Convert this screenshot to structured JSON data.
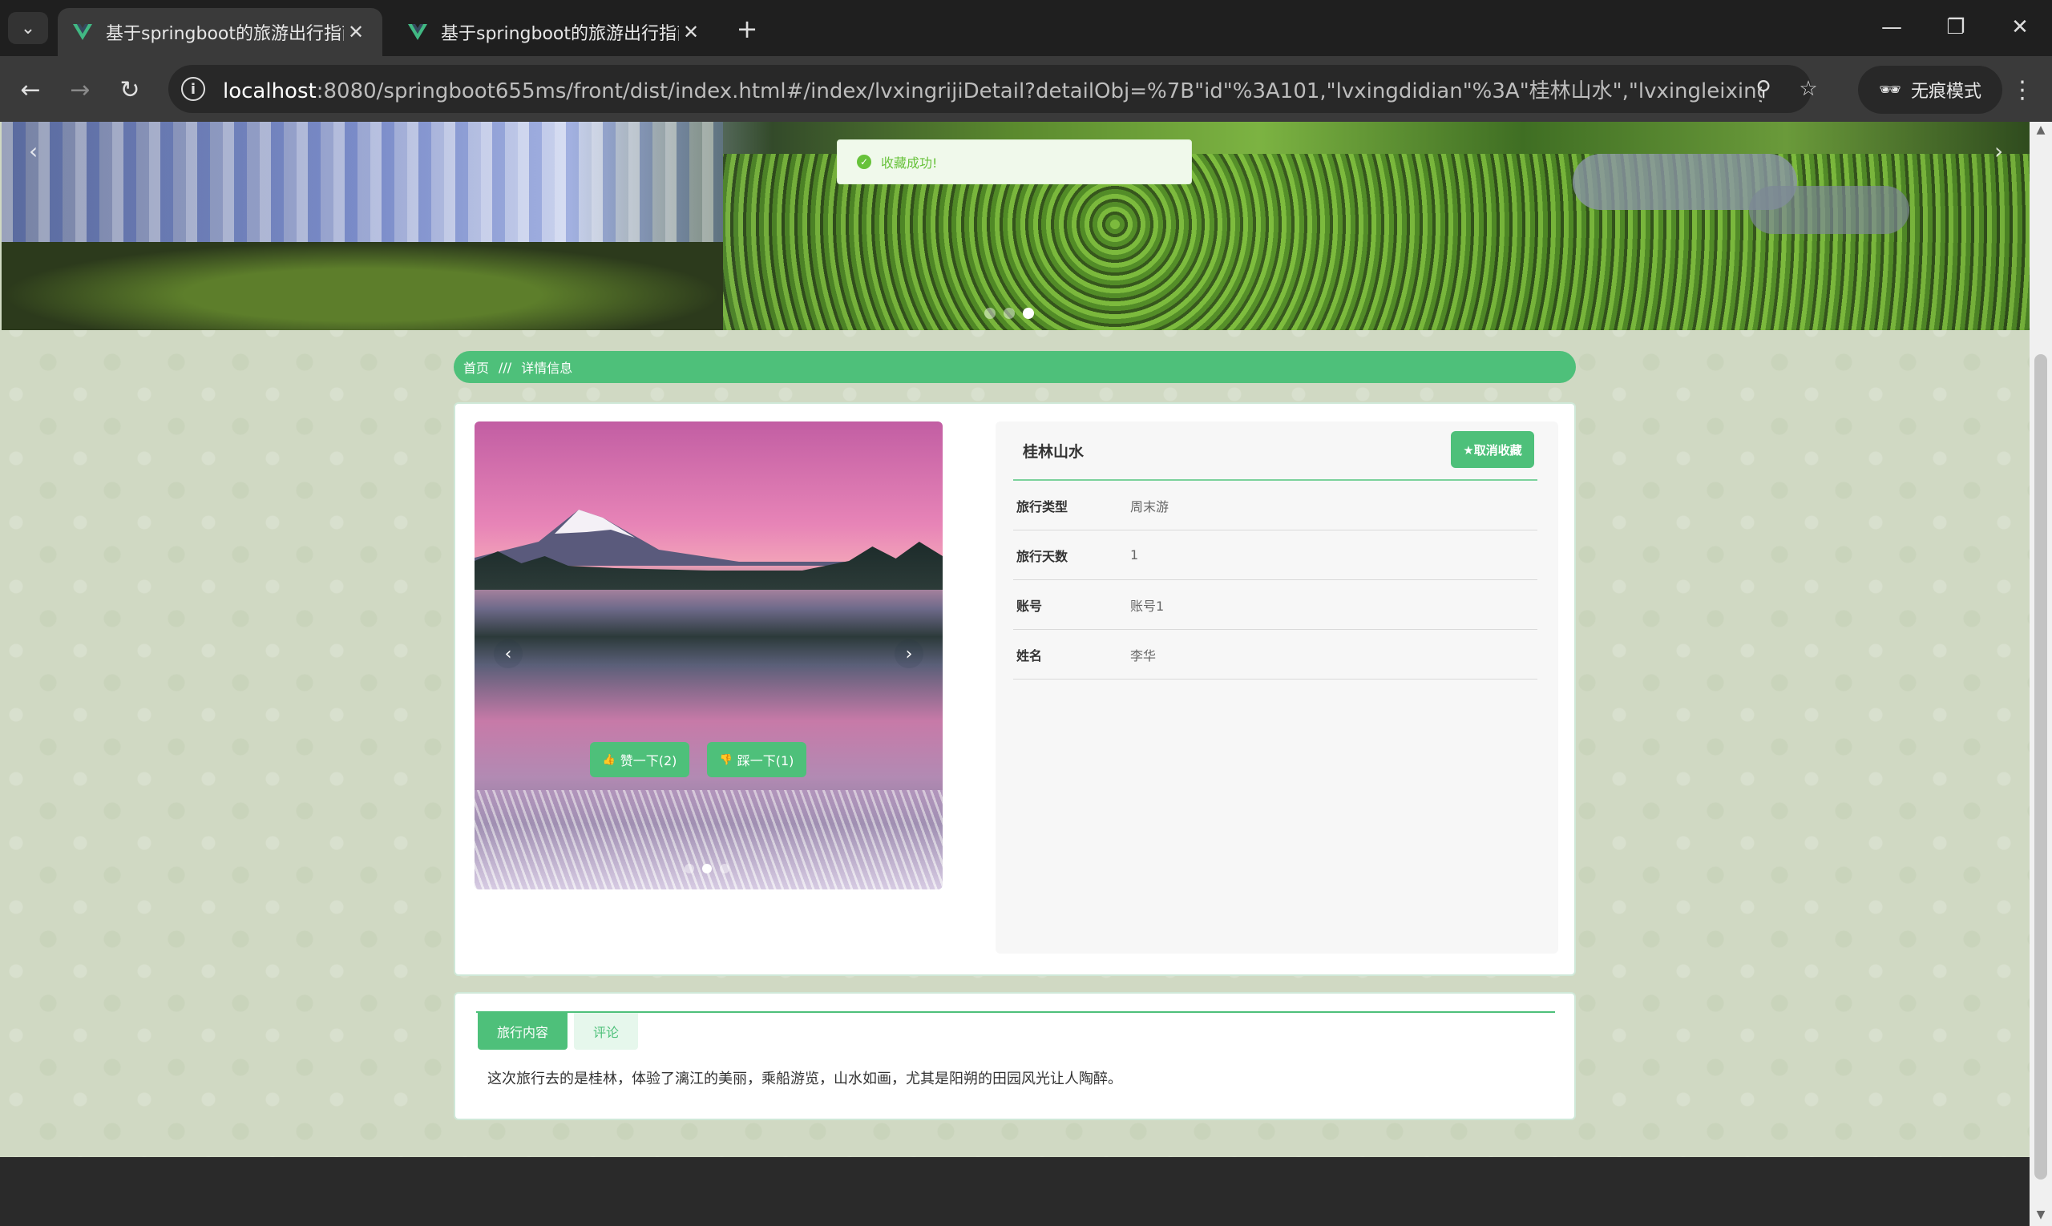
{
  "browser": {
    "tabs": [
      {
        "title": "基于springboot的旅游出行指南",
        "active": true
      },
      {
        "title": "基于springboot的旅游出行指南",
        "active": false
      }
    ],
    "url_host": "localhost",
    "url_rest": ":8080/springboot655ms/front/dist/index.html#/index/lvxingrijiDetail?detailObj=%7B\"id\"%3A101,\"lvxingdidian\"%3A\"桂林山水\",\"lvxingleixing\"%3A\"周末...",
    "incognito_label": "无痕模式",
    "icons": {
      "back": "←",
      "forward": "→",
      "reload": "↻",
      "info": "i",
      "zoom": "⚲",
      "star": "☆",
      "menu": "⌄",
      "close": "✕",
      "new_tab": "+",
      "minimize": "—",
      "restore": "❐",
      "kebab": "⋮",
      "check": "✓",
      "prev": "‹",
      "next": "›",
      "thumb_up": "👍",
      "thumb_down": "👎",
      "incognito": "🕶"
    }
  },
  "toast": {
    "message": "收藏成功!"
  },
  "breadcrumb": {
    "home": "首页",
    "separator": "///",
    "current": "详情信息"
  },
  "detail": {
    "title": "桂林山水",
    "favorite_button": "★取消收藏",
    "fields": [
      {
        "label": "旅行类型",
        "value": "周末游"
      },
      {
        "label": "旅行天数",
        "value": "1"
      },
      {
        "label": "账号",
        "value": "账号1"
      },
      {
        "label": "姓名",
        "value": "李华"
      }
    ],
    "like_button": "赞一下(2)",
    "dislike_button": "踩一下(1)"
  },
  "content_tabs": {
    "tabs": [
      "旅行内容",
      "评论"
    ],
    "active_index": 0,
    "text": "这次旅行去的是桂林，体验了漓江的美丽，乘船游览，山水如画，尤其是阳朔的田园风光让人陶醉。"
  },
  "carousel": {
    "banner_active": 3,
    "banner_count": 3,
    "photo_active": 2,
    "photo_count": 3
  },
  "colors": {
    "accent": "#4ec07a",
    "toast_bg": "#f0f9eb",
    "toast_text": "#67c23a",
    "page_bg": "#d0d9c3"
  }
}
